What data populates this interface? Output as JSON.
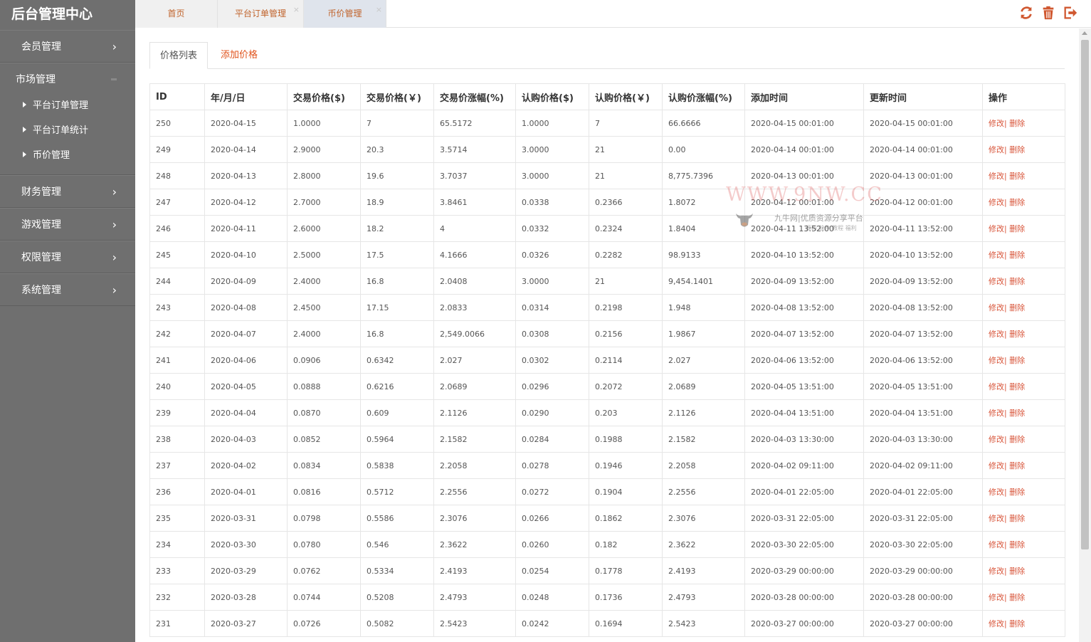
{
  "app": {
    "title": "后台管理中心"
  },
  "sidebar": {
    "items": [
      {
        "label": "会员管理"
      },
      {
        "label": "市场管理",
        "children": [
          "平台订单管理",
          "平台订单统计",
          "币价管理"
        ]
      },
      {
        "label": "财务管理"
      },
      {
        "label": "游戏管理"
      },
      {
        "label": "权限管理"
      },
      {
        "label": "系统管理"
      }
    ]
  },
  "tabs": [
    {
      "label": "首页",
      "closable": false
    },
    {
      "label": "平台订单管理",
      "closable": true
    },
    {
      "label": "币价管理",
      "closable": true,
      "active": true
    }
  ],
  "toolbar": {
    "icons": [
      "refresh-icon",
      "trash-icon",
      "logout-icon"
    ]
  },
  "subtabs": {
    "list": "价格列表",
    "add": "添加价格"
  },
  "table": {
    "columns": [
      "ID",
      "年/月/日",
      "交易价格($)",
      "交易价格(￥)",
      "交易价涨幅(%)",
      "认购价格($)",
      "认购价格(￥)",
      "认购价涨幅(%)",
      "添加时间",
      "更新时间",
      "操作"
    ],
    "action_edit": "修改|",
    "action_delete": " 删除",
    "rows": [
      [
        "250",
        "2020-04-15",
        "1.0000",
        "7",
        "65.5172",
        "1.0000",
        "7",
        "66.6666",
        "2020-04-15 00:01:00",
        "2020-04-15 00:01:00"
      ],
      [
        "249",
        "2020-04-14",
        "2.9000",
        "20.3",
        "3.5714",
        "3.0000",
        "21",
        "0.00",
        "2020-04-14 00:01:00",
        "2020-04-14 00:01:00"
      ],
      [
        "248",
        "2020-04-13",
        "2.8000",
        "19.6",
        "3.7037",
        "3.0000",
        "21",
        "8,775.7396",
        "2020-04-13 00:01:00",
        "2020-04-13 00:01:00"
      ],
      [
        "247",
        "2020-04-12",
        "2.7000",
        "18.9",
        "3.8461",
        "0.0338",
        "0.2366",
        "1.8072",
        "2020-04-12 00:01:00",
        "2020-04-12 00:01:00"
      ],
      [
        "246",
        "2020-04-11",
        "2.6000",
        "18.2",
        "4",
        "0.0332",
        "0.2324",
        "1.8404",
        "2020-04-11 13:52:00",
        "2020-04-11 13:52:00"
      ],
      [
        "245",
        "2020-04-10",
        "2.5000",
        "17.5",
        "4.1666",
        "0.0326",
        "0.2282",
        "98.9133",
        "2020-04-10 13:52:00",
        "2020-04-10 13:52:00"
      ],
      [
        "244",
        "2020-04-09",
        "2.4000",
        "16.8",
        "2.0408",
        "3.0000",
        "21",
        "9,454.1401",
        "2020-04-09 13:52:00",
        "2020-04-09 13:52:00"
      ],
      [
        "243",
        "2020-04-08",
        "2.4500",
        "17.15",
        "2.0833",
        "0.0314",
        "0.2198",
        "1.948",
        "2020-04-08 13:52:00",
        "2020-04-08 13:52:00"
      ],
      [
        "242",
        "2020-04-07",
        "2.4000",
        "16.8",
        "2,549.0066",
        "0.0308",
        "0.2156",
        "1.9867",
        "2020-04-07 13:52:00",
        "2020-04-07 13:52:00"
      ],
      [
        "241",
        "2020-04-06",
        "0.0906",
        "0.6342",
        "2.027",
        "0.0302",
        "0.2114",
        "2.027",
        "2020-04-06 13:52:00",
        "2020-04-06 13:52:00"
      ],
      [
        "240",
        "2020-04-05",
        "0.0888",
        "0.6216",
        "2.0689",
        "0.0296",
        "0.2072",
        "2.0689",
        "2020-04-05 13:51:00",
        "2020-04-05 13:51:00"
      ],
      [
        "239",
        "2020-04-04",
        "0.0870",
        "0.609",
        "2.1126",
        "0.0290",
        "0.203",
        "2.1126",
        "2020-04-04 13:51:00",
        "2020-04-04 13:51:00"
      ],
      [
        "238",
        "2020-04-03",
        "0.0852",
        "0.5964",
        "2.1582",
        "0.0284",
        "0.1988",
        "2.1582",
        "2020-04-03 13:30:00",
        "2020-04-03 13:30:00"
      ],
      [
        "237",
        "2020-04-02",
        "0.0834",
        "0.5838",
        "2.2058",
        "0.0278",
        "0.1946",
        "2.2058",
        "2020-04-02 09:11:00",
        "2020-04-02 09:11:00"
      ],
      [
        "236",
        "2020-04-01",
        "0.0816",
        "0.5712",
        "2.2556",
        "0.0272",
        "0.1904",
        "2.2556",
        "2020-04-01 22:05:00",
        "2020-04-01 22:05:00"
      ],
      [
        "235",
        "2020-03-31",
        "0.0798",
        "0.5586",
        "2.3076",
        "0.0266",
        "0.1862",
        "2.3076",
        "2020-03-31 22:05:00",
        "2020-03-31 22:05:00"
      ],
      [
        "234",
        "2020-03-30",
        "0.0780",
        "0.546",
        "2.3622",
        "0.0260",
        "0.182",
        "2.3622",
        "2020-03-30 22:05:00",
        "2020-03-30 22:05:00"
      ],
      [
        "233",
        "2020-03-29",
        "0.0762",
        "0.5334",
        "2.4193",
        "0.0254",
        "0.1778",
        "2.4193",
        "2020-03-29 00:00:00",
        "2020-03-29 00:00:00"
      ],
      [
        "232",
        "2020-03-28",
        "0.0744",
        "0.5208",
        "2.4793",
        "0.0248",
        "0.1736",
        "2.4793",
        "2020-03-28 00:00:00",
        "2020-03-28 00:00:00"
      ],
      [
        "231",
        "2020-03-27",
        "0.0726",
        "0.5082",
        "2.5423",
        "0.0242",
        "0.1694",
        "2.5423",
        "2020-03-27 00:00:00",
        "2020-03-27 00:00:00"
      ]
    ]
  },
  "watermark": {
    "url": "WWW.9NW.CC",
    "name": "九牛网|优质资源分享平台",
    "tagline": "源码 软件 教程 福利"
  },
  "colors": {
    "sidebar_bg": "#6f6f6f",
    "accent": "#e0521b",
    "link": "#d8553a"
  }
}
